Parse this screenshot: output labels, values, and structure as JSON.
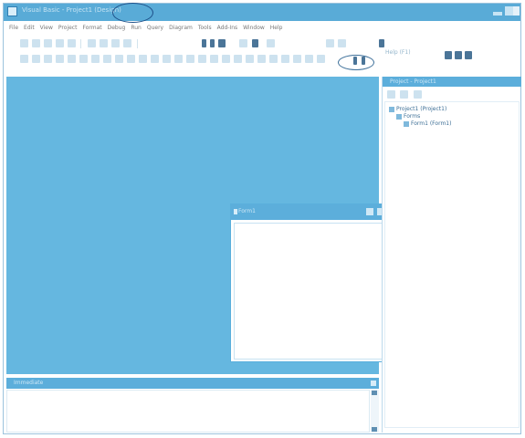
{
  "window": {
    "title": "Visual Basic - Project1 (Design)"
  },
  "menu": [
    {
      "label": "File"
    },
    {
      "label": "Edit"
    },
    {
      "label": "View"
    },
    {
      "label": "Project"
    },
    {
      "label": "Format"
    },
    {
      "label": "Debug"
    },
    {
      "label": "Run"
    },
    {
      "label": "Query"
    },
    {
      "label": "Diagram"
    },
    {
      "label": "Tools"
    },
    {
      "label": "Add-Ins"
    },
    {
      "label": "Window"
    },
    {
      "label": "Help"
    }
  ],
  "toolbar": {
    "help_label": "Help (F1)"
  },
  "dialog": {
    "title": "Form1"
  },
  "project_panel": {
    "title": "Project - Project1",
    "tree": [
      {
        "label": "Project1 (Project1)",
        "depth": 0
      },
      {
        "label": "Forms",
        "depth": 1
      },
      {
        "label": "Form1 (Form1)",
        "depth": 2
      }
    ]
  },
  "immediate_panel": {
    "title": "Immediate"
  },
  "colors": {
    "accent": "#59abd7",
    "workspace": "#65b7e0",
    "highlight_ring": "#1d4f88"
  }
}
